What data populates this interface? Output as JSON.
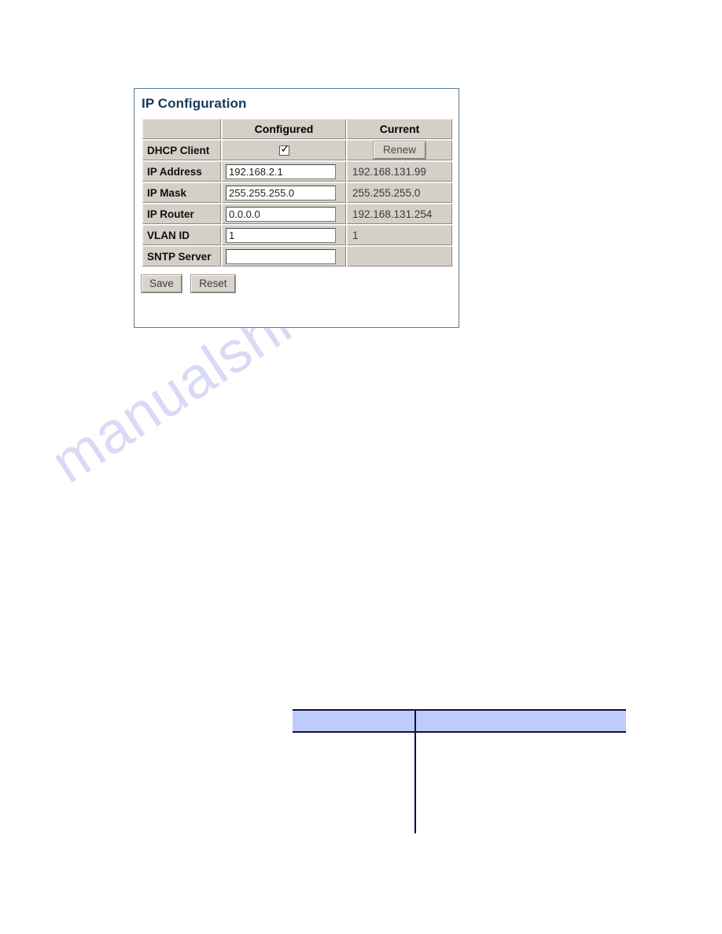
{
  "page": {
    "background_color": "#ffffff",
    "watermark_text": "manualshive.com",
    "watermark_color": "#d9daf5"
  },
  "panel": {
    "title": "IP Configuration",
    "border_color": "#5c7f92",
    "title_color": "#17375e",
    "table": {
      "headers": [
        "",
        "Configured",
        "Current"
      ],
      "rows": [
        {
          "label": "DHCP Client",
          "configured_type": "checkbox",
          "configured_checked": true,
          "configured_value": "",
          "current_type": "button",
          "current_value": "Renew"
        },
        {
          "label": "IP Address",
          "configured_type": "text",
          "configured_value": "192.168.2.1",
          "current_type": "text",
          "current_value": "192.168.131.99"
        },
        {
          "label": "IP Mask",
          "configured_type": "text",
          "configured_value": "255.255.255.0",
          "current_type": "text",
          "current_value": "255.255.255.0"
        },
        {
          "label": "IP Router",
          "configured_type": "text",
          "configured_value": "0.0.0.0",
          "current_type": "text",
          "current_value": "192.168.131.254"
        },
        {
          "label": "VLAN ID",
          "configured_type": "text",
          "configured_value": "1",
          "current_type": "text",
          "current_value": "1"
        },
        {
          "label": "SNTP Server",
          "configured_type": "text",
          "configured_value": "",
          "current_type": "text",
          "current_value": ""
        }
      ]
    },
    "buttons": {
      "save_label": "Save",
      "reset_label": "Reset"
    }
  },
  "bottom_table": {
    "header_color": "#bdccfa",
    "border_color": "#0b1140",
    "header_cells": [
      "",
      ""
    ],
    "body_cells": [
      "",
      ""
    ]
  }
}
